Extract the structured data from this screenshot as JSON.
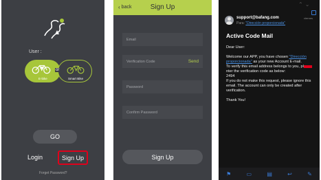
{
  "landing": {
    "user_label": "User :",
    "or_label": "or",
    "ebike_caption": "E-bike",
    "smart_caption": "Smart Bike",
    "go_label": "GO",
    "login_label": "Login",
    "signup_label": "Sign Up",
    "forgot_label": "Forget Password?"
  },
  "signup": {
    "back_label": "back",
    "title": "Sign Up",
    "email_placeholder": "Email",
    "verification_placeholder": "Verification Code",
    "send_label": "Send",
    "password_placeholder": "Password",
    "confirm_placeholder": "Confirm Password",
    "submit_label": "Sign Up"
  },
  "email": {
    "sender": "support@bafang.com",
    "date": "viernes",
    "to_prefix": "Para:",
    "to_recipient": "\"Dirección proporcionada\"",
    "subject": "Active Code Mail",
    "greeting": "Dear User:",
    "line1_pre": "Welcome our APP, you have chosen",
    "line1_link": "\"Dirección proporcionada\"",
    "line1_post": "as your new Account E-mail.",
    "line2_pre": "To verify this email address belongs to you, pl",
    "line2_post": "nter the verification code as below:",
    "code": "2494",
    "line3": "If you do not make this request, please ignore this email. The account can only be created after verification.",
    "thanks": "Thank You!"
  },
  "colors": {
    "accent_green": "#b6d04d",
    "dark_panel": "#3d3f44",
    "highlight_red": "#e0001b",
    "link_blue": "#4a90e2"
  },
  "icons": [
    "bike-logo-icon",
    "ebike-icon",
    "smart-bike-icon",
    "back-chevron-icon",
    "avatar",
    "trash-icon",
    "toolbar-icons"
  ]
}
